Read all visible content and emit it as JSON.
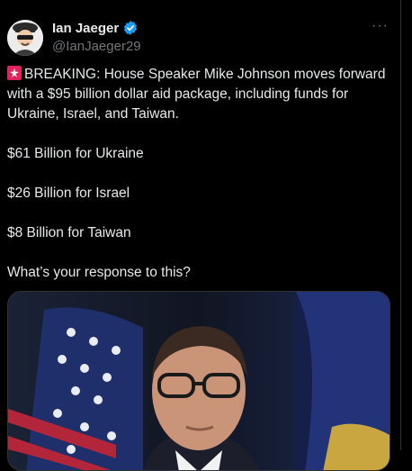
{
  "tweet": {
    "author": {
      "display_name": "Ian Jaeger",
      "handle": "@IanJaeger29",
      "verified": true,
      "avatar_icon": "avatar-illustration-icon"
    },
    "more_label": "···",
    "lines": [
      {
        "type": "para",
        "icon": "rotating-light-icon",
        "text": "BREAKING: House Speaker Mike Johnson moves forward with a $95 billion dollar aid package, including funds for Ukraine, Israel, and Taiwan."
      },
      {
        "type": "para",
        "text": "$61 Billion for Ukraine"
      },
      {
        "type": "para",
        "text": "$26 Billion for Israel"
      },
      {
        "type": "para",
        "text": "$8 Billion for Taiwan"
      },
      {
        "type": "para",
        "text": "What’s your response to this?"
      }
    ],
    "media": {
      "kind": "photo",
      "subject": "man-in-glasses-in-front-of-flags"
    }
  },
  "colors": {
    "background": "#000000",
    "text": "#e7e9ea",
    "muted": "#71767b",
    "verified": "#1d9bf0",
    "border": "#2f3336"
  }
}
